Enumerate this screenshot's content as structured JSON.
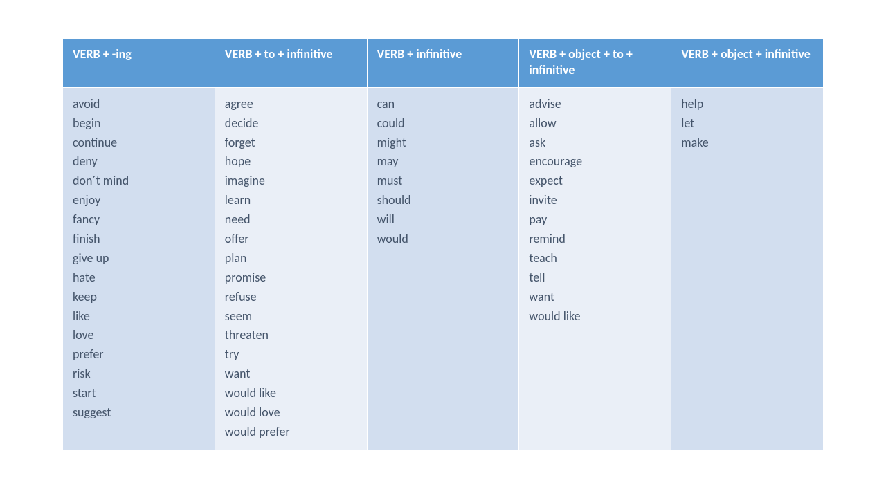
{
  "columns": [
    {
      "header": "VERB + -ing",
      "items": [
        "avoid",
        "begin",
        "continue",
        "deny",
        "don´t mind",
        "enjoy",
        "fancy",
        "finish",
        "give up",
        "hate",
        "keep",
        "like",
        "love",
        "prefer",
        "risk",
        "start",
        "suggest"
      ]
    },
    {
      "header": "VERB + to + infinitive",
      "items": [
        "agree",
        "decide",
        "forget",
        "hope",
        "imagine",
        "learn",
        "need",
        "offer",
        "plan",
        "promise",
        "refuse",
        "seem",
        "threaten",
        "try",
        "want",
        "would like",
        "would love",
        "would prefer"
      ]
    },
    {
      "header": "VERB + infinitive",
      "items": [
        "can",
        "could",
        "might",
        "may",
        "must",
        "should",
        "will",
        "would"
      ]
    },
    {
      "header": "VERB + object + to + infinitive",
      "items": [
        "advise",
        "allow",
        "ask",
        "encourage",
        "expect",
        "invite",
        "pay",
        "remind",
        "teach",
        "tell",
        "want",
        "would like"
      ]
    },
    {
      "header": "VERB + object + infinitive",
      "items": [
        "help",
        "let",
        "make"
      ]
    }
  ]
}
